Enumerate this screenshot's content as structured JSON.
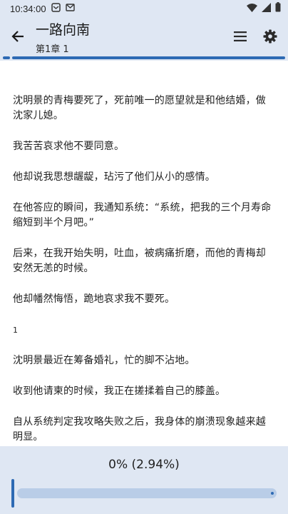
{
  "status_bar": {
    "time": "10:34:00"
  },
  "app_bar": {
    "title": "一路向南",
    "subtitle": "第1章 1"
  },
  "content": {
    "paragraphs": [
      "沈明景的青梅要死了，死前唯一的愿望就是和他结婚，做沈家儿媳。",
      "我苦苦哀求他不要同意。",
      "他却说我思想龌龊，玷污了他们从小的感情。",
      "在他答应的瞬间，我通知系统：“系统，把我的三个月寿命缩短到半个月吧。”",
      "后来，在我开始失明，吐血，被病痛折磨，而他的青梅却安然无恙的时候。",
      "他却幡然悔悟，跪地哀求我不要死。",
      "1",
      "沈明景最近在筹备婚礼，忙的脚不沾地。",
      "收到他请柬的时候，我正在搓揉着自己的膝盖。",
      "自从系统判定我攻略失败之后，我身体的崩溃现象越来越明显。"
    ]
  },
  "reading_progress": {
    "label": "0% (2.94%)",
    "fraction": 0.0294
  },
  "colors": {
    "bar_background": "#dfe7f3",
    "accent": "#2d6ab4",
    "slider_track": "#b9cde7"
  }
}
